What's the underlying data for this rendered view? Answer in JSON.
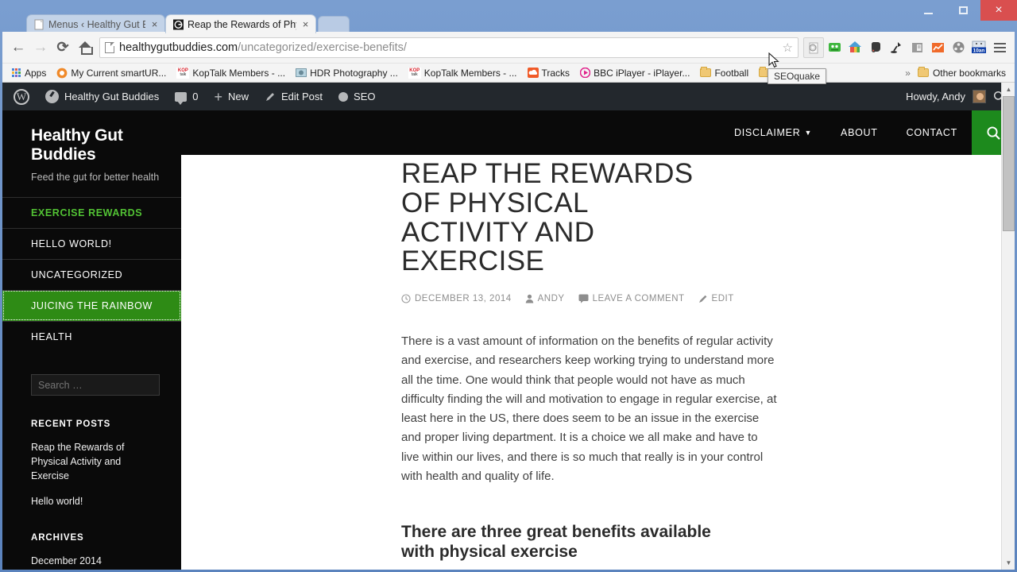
{
  "window": {
    "minimize_label": "Minimize",
    "maximize_label": "Maximize",
    "close_label": "×"
  },
  "tabs": [
    {
      "title": "Menus ‹ Healthy Gut Budd",
      "close": "×",
      "active": false
    },
    {
      "title": "Reap the Rewards of Physi",
      "close": "×",
      "active": true
    }
  ],
  "toolbar": {
    "back": "←",
    "forward": "→",
    "reload": "⟳",
    "home_icon": "home-icon",
    "url_host": "healthygutbuddies.com",
    "url_path": "/uncategorized/exercise-benefits/",
    "bookmark_star": "☆",
    "extensions": [
      "seoquake-icon",
      "green-robot-icon",
      "colorful-house-icon",
      "evernote-elephant-icon",
      "desk-lamp-icon",
      "document-reader-icon",
      "orange-chart-icon",
      "film-reel-icon",
      "10an-badge-icon"
    ],
    "badge_text": "10an",
    "menu_label": "Customize and control Google Chrome",
    "tooltip": "SEOquake"
  },
  "bookmarks": {
    "apps_label": "Apps",
    "items": [
      {
        "label": "My Current smartUR...",
        "icon": "orange-circle-icon"
      },
      {
        "label": "KopTalk Members - ...",
        "icon": "koptalk-icon"
      },
      {
        "label": "HDR Photography ...",
        "icon": "photo-icon"
      },
      {
        "label": "KopTalk Members - ...",
        "icon": "koptalk-icon"
      },
      {
        "label": "Tracks",
        "icon": "soundcloud-icon"
      },
      {
        "label": "BBC iPlayer - iPlayer...",
        "icon": "bbc-iplayer-icon"
      },
      {
        "label": "Football",
        "icon": "folder-icon"
      }
    ],
    "overflow": "»",
    "other_bookmarks": "Other bookmarks"
  },
  "adminbar": {
    "wp_logo": "wordpress-logo",
    "site_name": "Healthy Gut Buddies",
    "comment_count": "0",
    "new_label": "New",
    "edit_post_label": "Edit Post",
    "seo_label": "SEO",
    "howdy": "Howdy, Andy",
    "search_icon": "search-icon"
  },
  "site": {
    "title": "Healthy Gut Buddies",
    "tagline": "Feed the gut for better health",
    "nav": [
      {
        "label": "DISCLAIMER",
        "has_dropdown": true
      },
      {
        "label": "ABOUT",
        "has_dropdown": false
      },
      {
        "label": "CONTACT",
        "has_dropdown": false
      }
    ],
    "search_button_icon": "search-icon"
  },
  "sidebar": {
    "menu": [
      {
        "label": "EXERCISE REWARDS",
        "state": "current"
      },
      {
        "label": "HELLO WORLD!",
        "state": "normal"
      },
      {
        "label": "UNCATEGORIZED",
        "state": "normal"
      },
      {
        "label": "JUICING THE RAINBOW",
        "state": "hover"
      },
      {
        "label": "HEALTH",
        "state": "normal"
      }
    ],
    "search_placeholder": "Search …",
    "recent_posts_title": "RECENT POSTS",
    "recent_posts": [
      "Reap the Rewards of Physical Activity and Exercise",
      "Hello world!"
    ],
    "archives_title": "ARCHIVES",
    "archives": [
      "December 2014"
    ]
  },
  "post": {
    "title": "Reap the Rewards of Physical Activity and Exercise",
    "date": "DECEMBER 13, 2014",
    "author": "ANDY",
    "comment_link": "LEAVE A COMMENT",
    "edit_link": "EDIT",
    "body": "There is a vast amount of information on the benefits of regular activity and exercise, and researchers keep working trying to understand more all the time. One would think that people would not have as much difficulty finding the will and motivation to engage in regular exercise, at least here in the US, there does seem to be an issue in the exercise and proper living department. It is a choice we all make and have to live within our lives, and there is so much that really is in your control with health and quality of life.",
    "subheading": "There are three great benefits available with physical exercise"
  },
  "colors": {
    "accent_green": "#2e8b15",
    "link_green": "#52c234",
    "search_button": "#1d8a1d",
    "adminbar": "#23282d",
    "sidebar": "#0a0a0a",
    "window_chrome": "#5b83bd"
  }
}
